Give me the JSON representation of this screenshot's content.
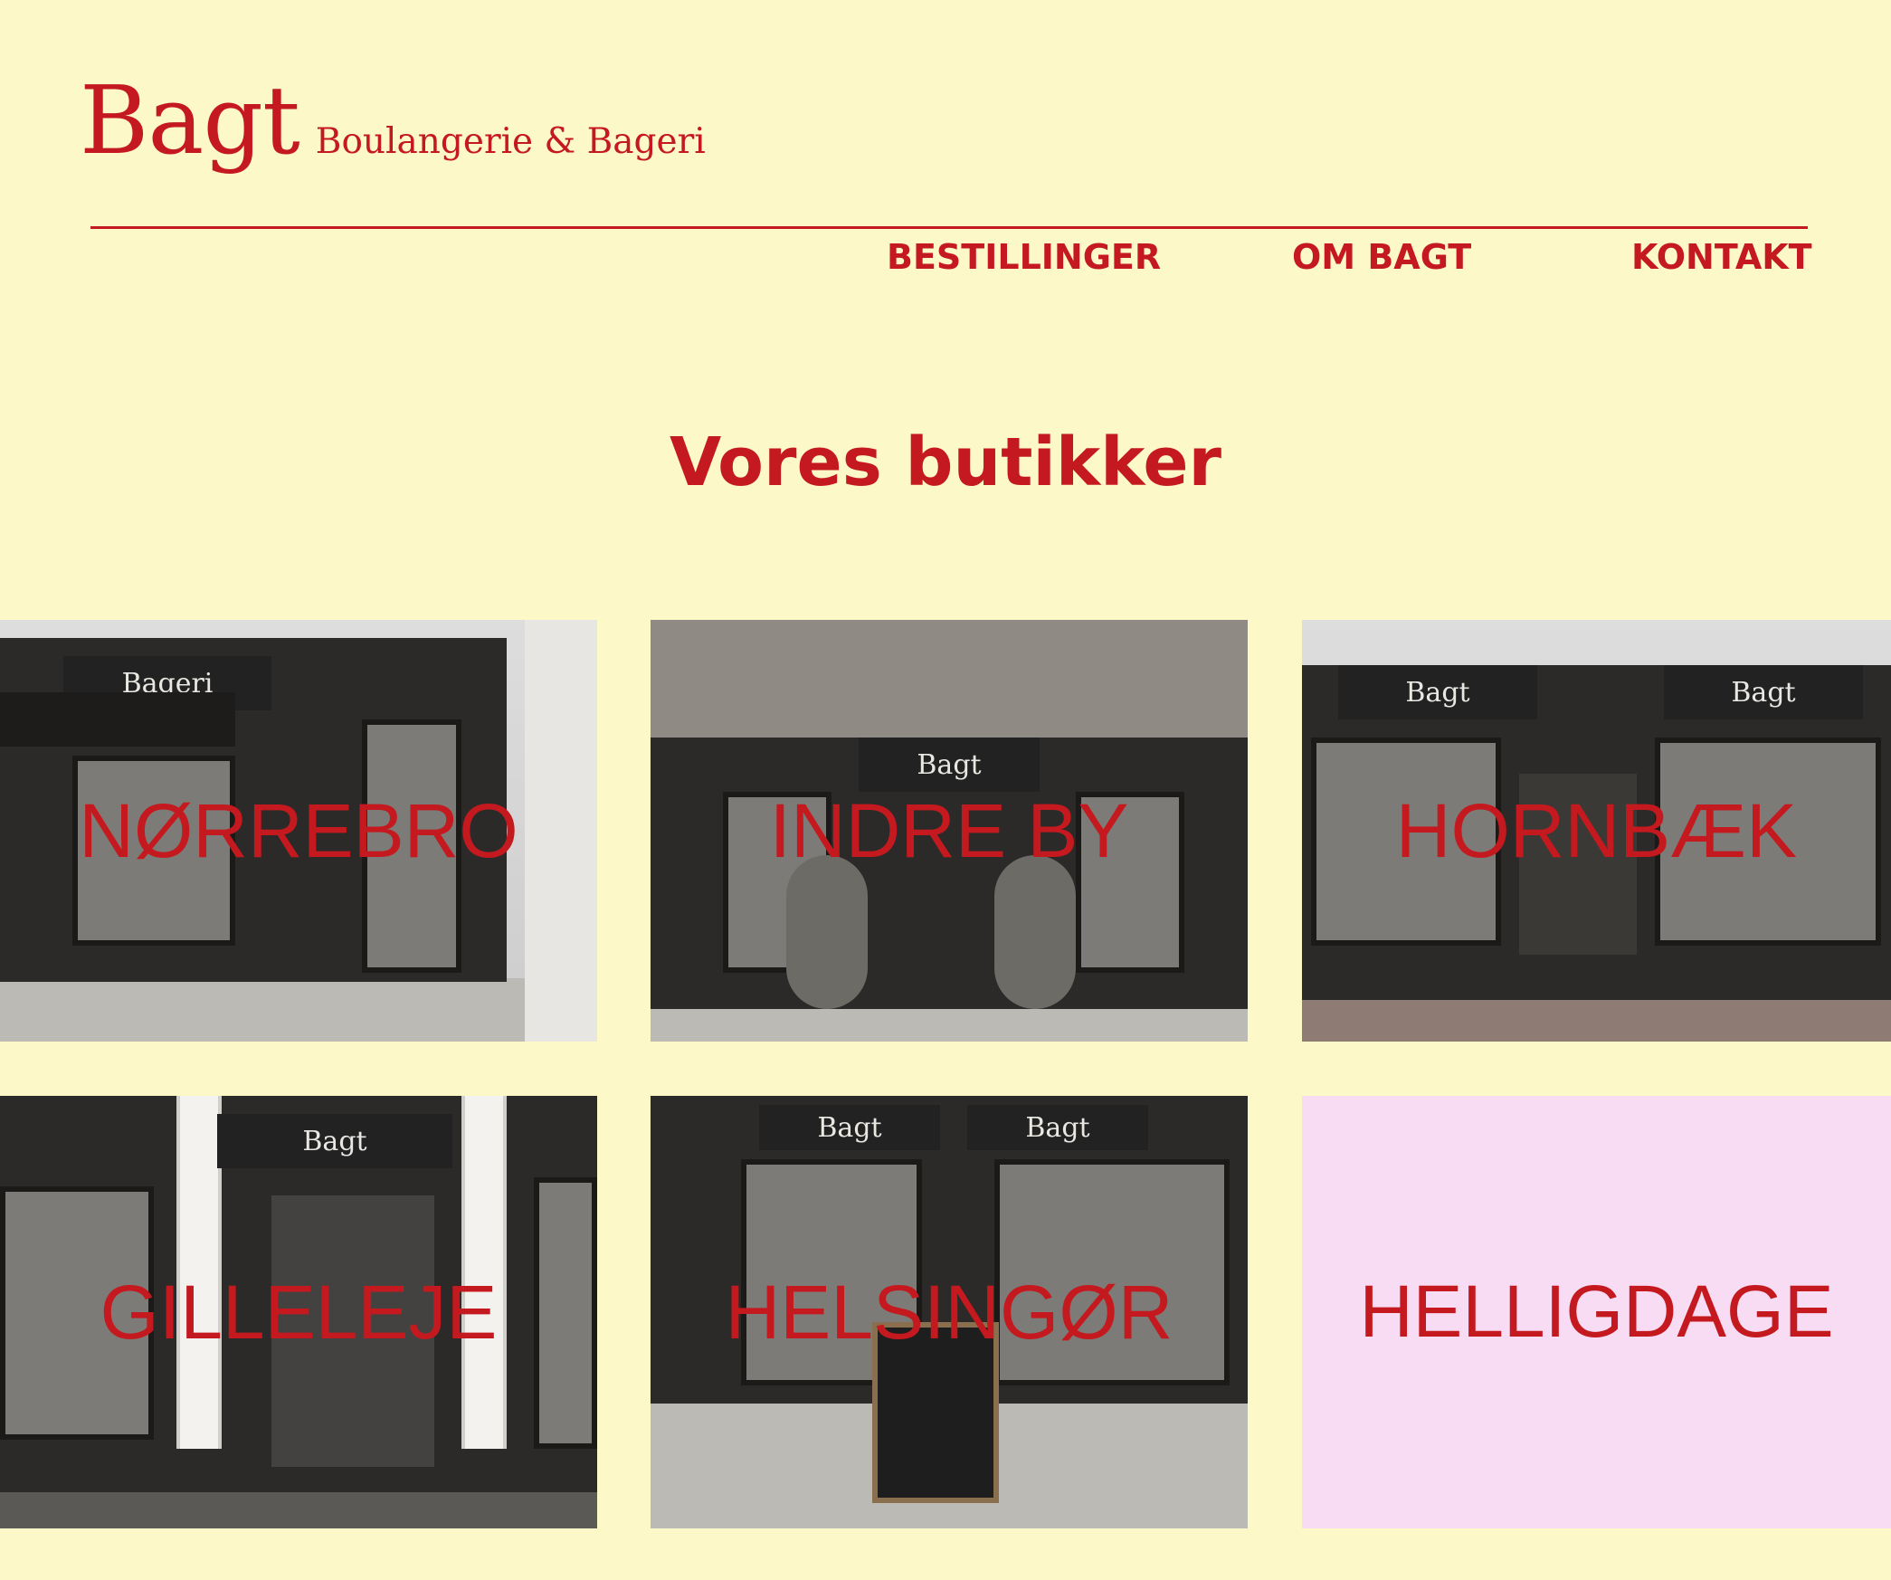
{
  "header": {
    "logo_main": "Bagt",
    "logo_sub": "Boulangerie & Bageri"
  },
  "nav": {
    "items": [
      "BESTILLINGER",
      "OM BAGT",
      "KONTAKT"
    ]
  },
  "main": {
    "title": "Vores butikker",
    "tiles": [
      {
        "label": "NØRREBRO",
        "sign": "Bageri"
      },
      {
        "label": "INDRE BY",
        "sign": "Bagt"
      },
      {
        "label": "HORNBÆK",
        "sign": "Bagt"
      },
      {
        "label": "GILLELEJE",
        "sign": "Bagt"
      },
      {
        "label": "HELSINGØR",
        "sign": "Bagt"
      },
      {
        "label": "HELLIGDAGE"
      }
    ]
  },
  "colors": {
    "background": "#fdf8c8",
    "accent": "#c41a1f",
    "holiday_tile": "#f8dcf3"
  }
}
